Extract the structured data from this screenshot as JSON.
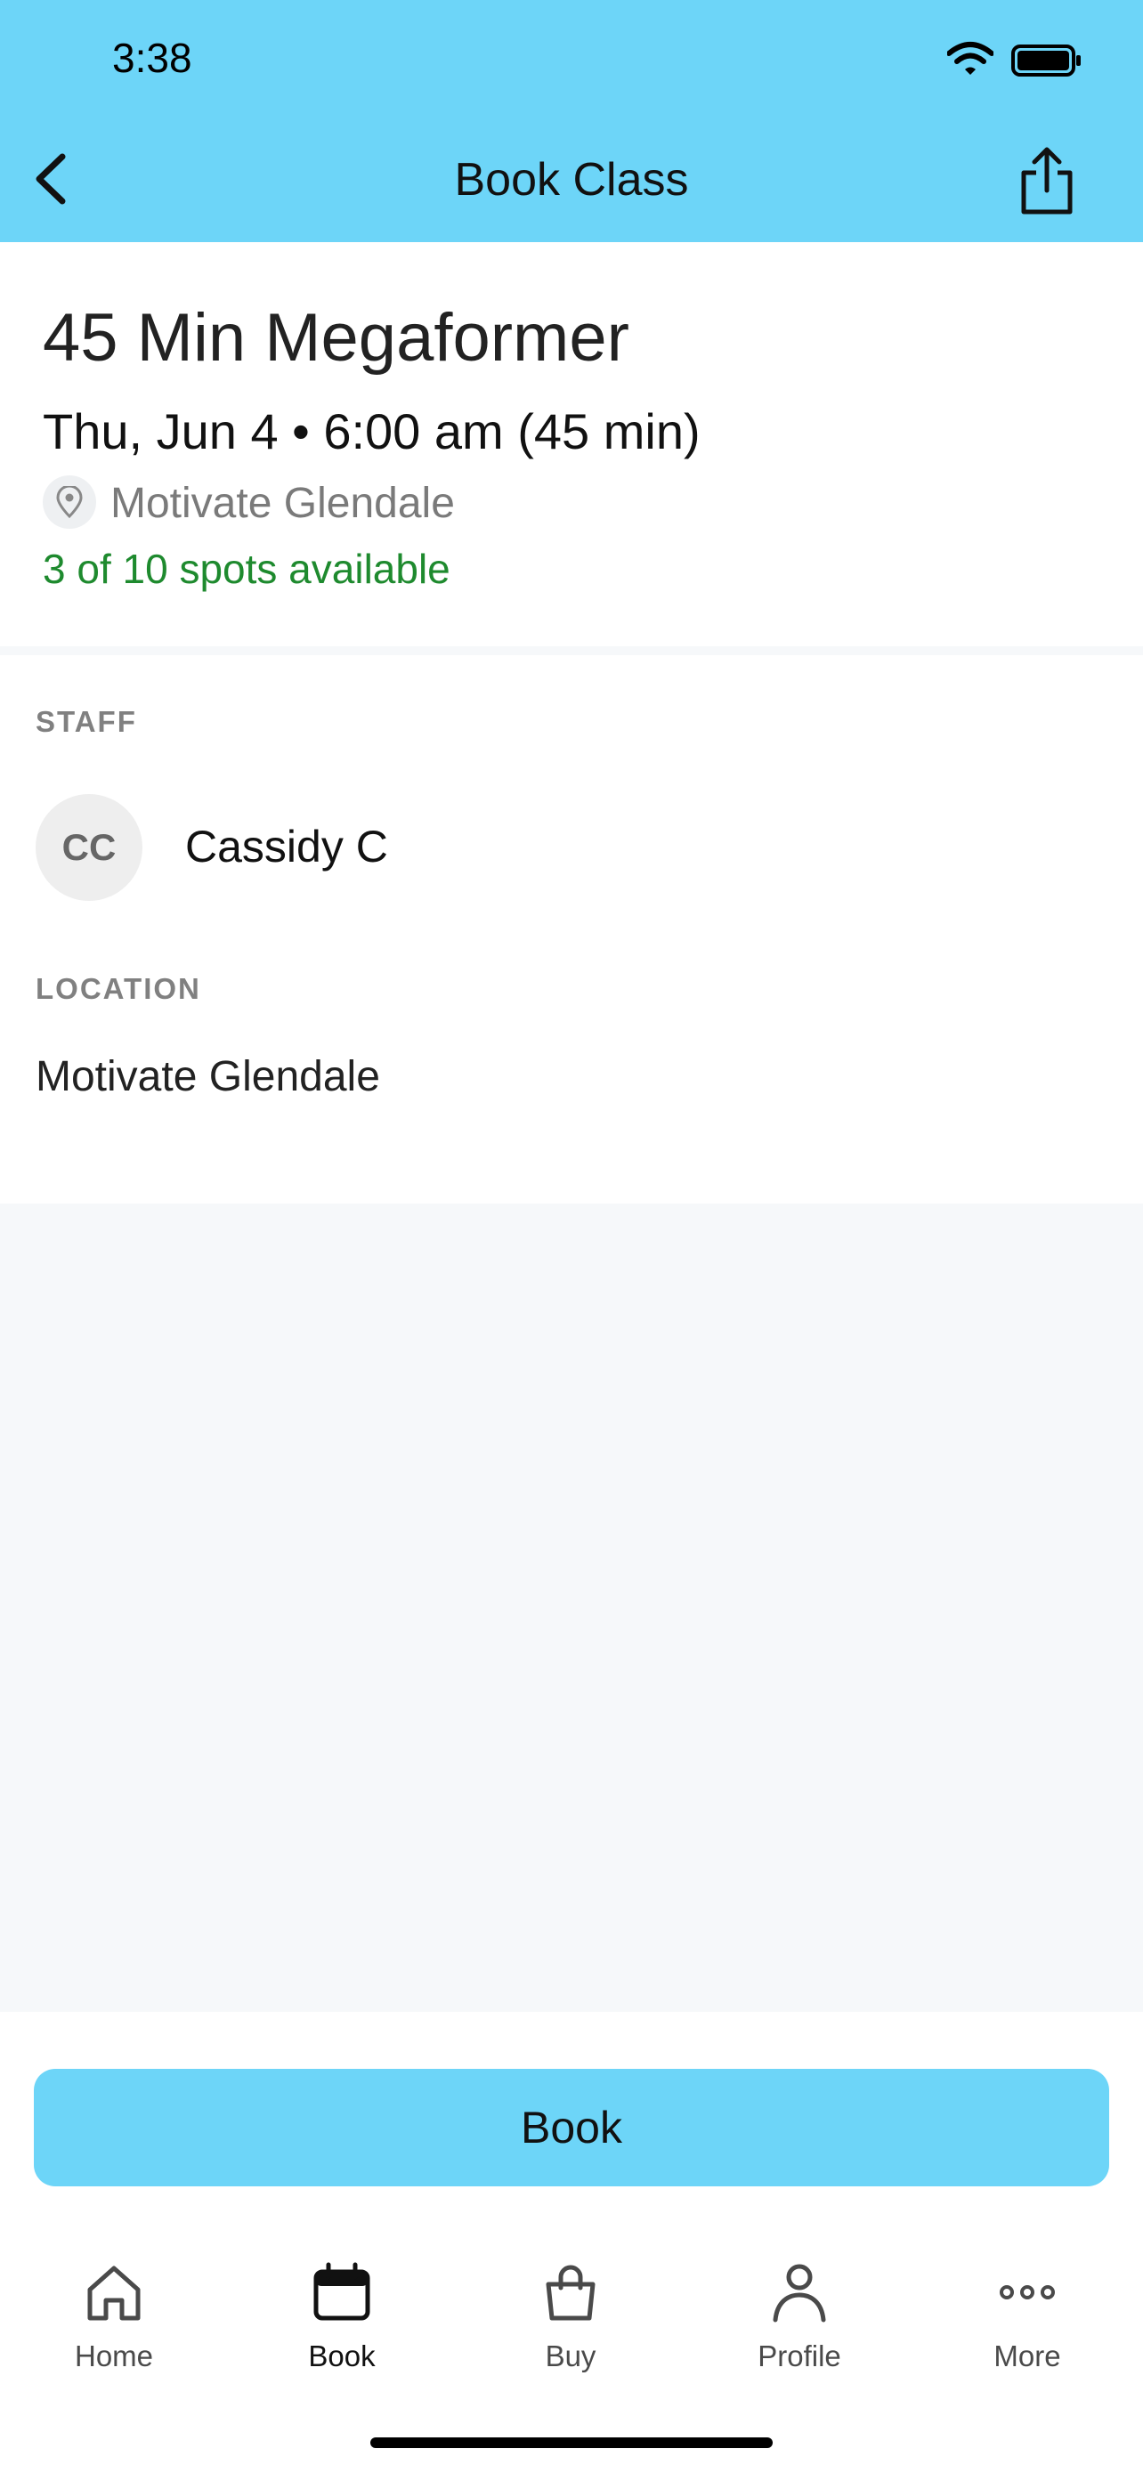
{
  "status_bar": {
    "time": "3:38"
  },
  "nav": {
    "title": "Book Class"
  },
  "class": {
    "title": "45 Min Megaformer",
    "when": "Thu, Jun 4 • 6:00 am (45 min)",
    "location": "Motivate Glendale",
    "availability": "3 of 10 spots available"
  },
  "staff": {
    "label": "STAFF",
    "initials": "CC",
    "name": "Cassidy C"
  },
  "location": {
    "label": "LOCATION",
    "name": "Motivate Glendale"
  },
  "book_button": {
    "label": "Book"
  },
  "tabs": [
    {
      "label": "Home",
      "icon": "home-icon"
    },
    {
      "label": "Book",
      "icon": "calendar-icon",
      "active": true
    },
    {
      "label": "Buy",
      "icon": "shopping-bag-icon"
    },
    {
      "label": "Profile",
      "icon": "person-icon"
    },
    {
      "label": "More",
      "icon": "more-dots-icon"
    }
  ],
  "colors": {
    "accent": "#6DD5F8",
    "availability": "#1E8A2E",
    "background": "#F6F8FA"
  }
}
